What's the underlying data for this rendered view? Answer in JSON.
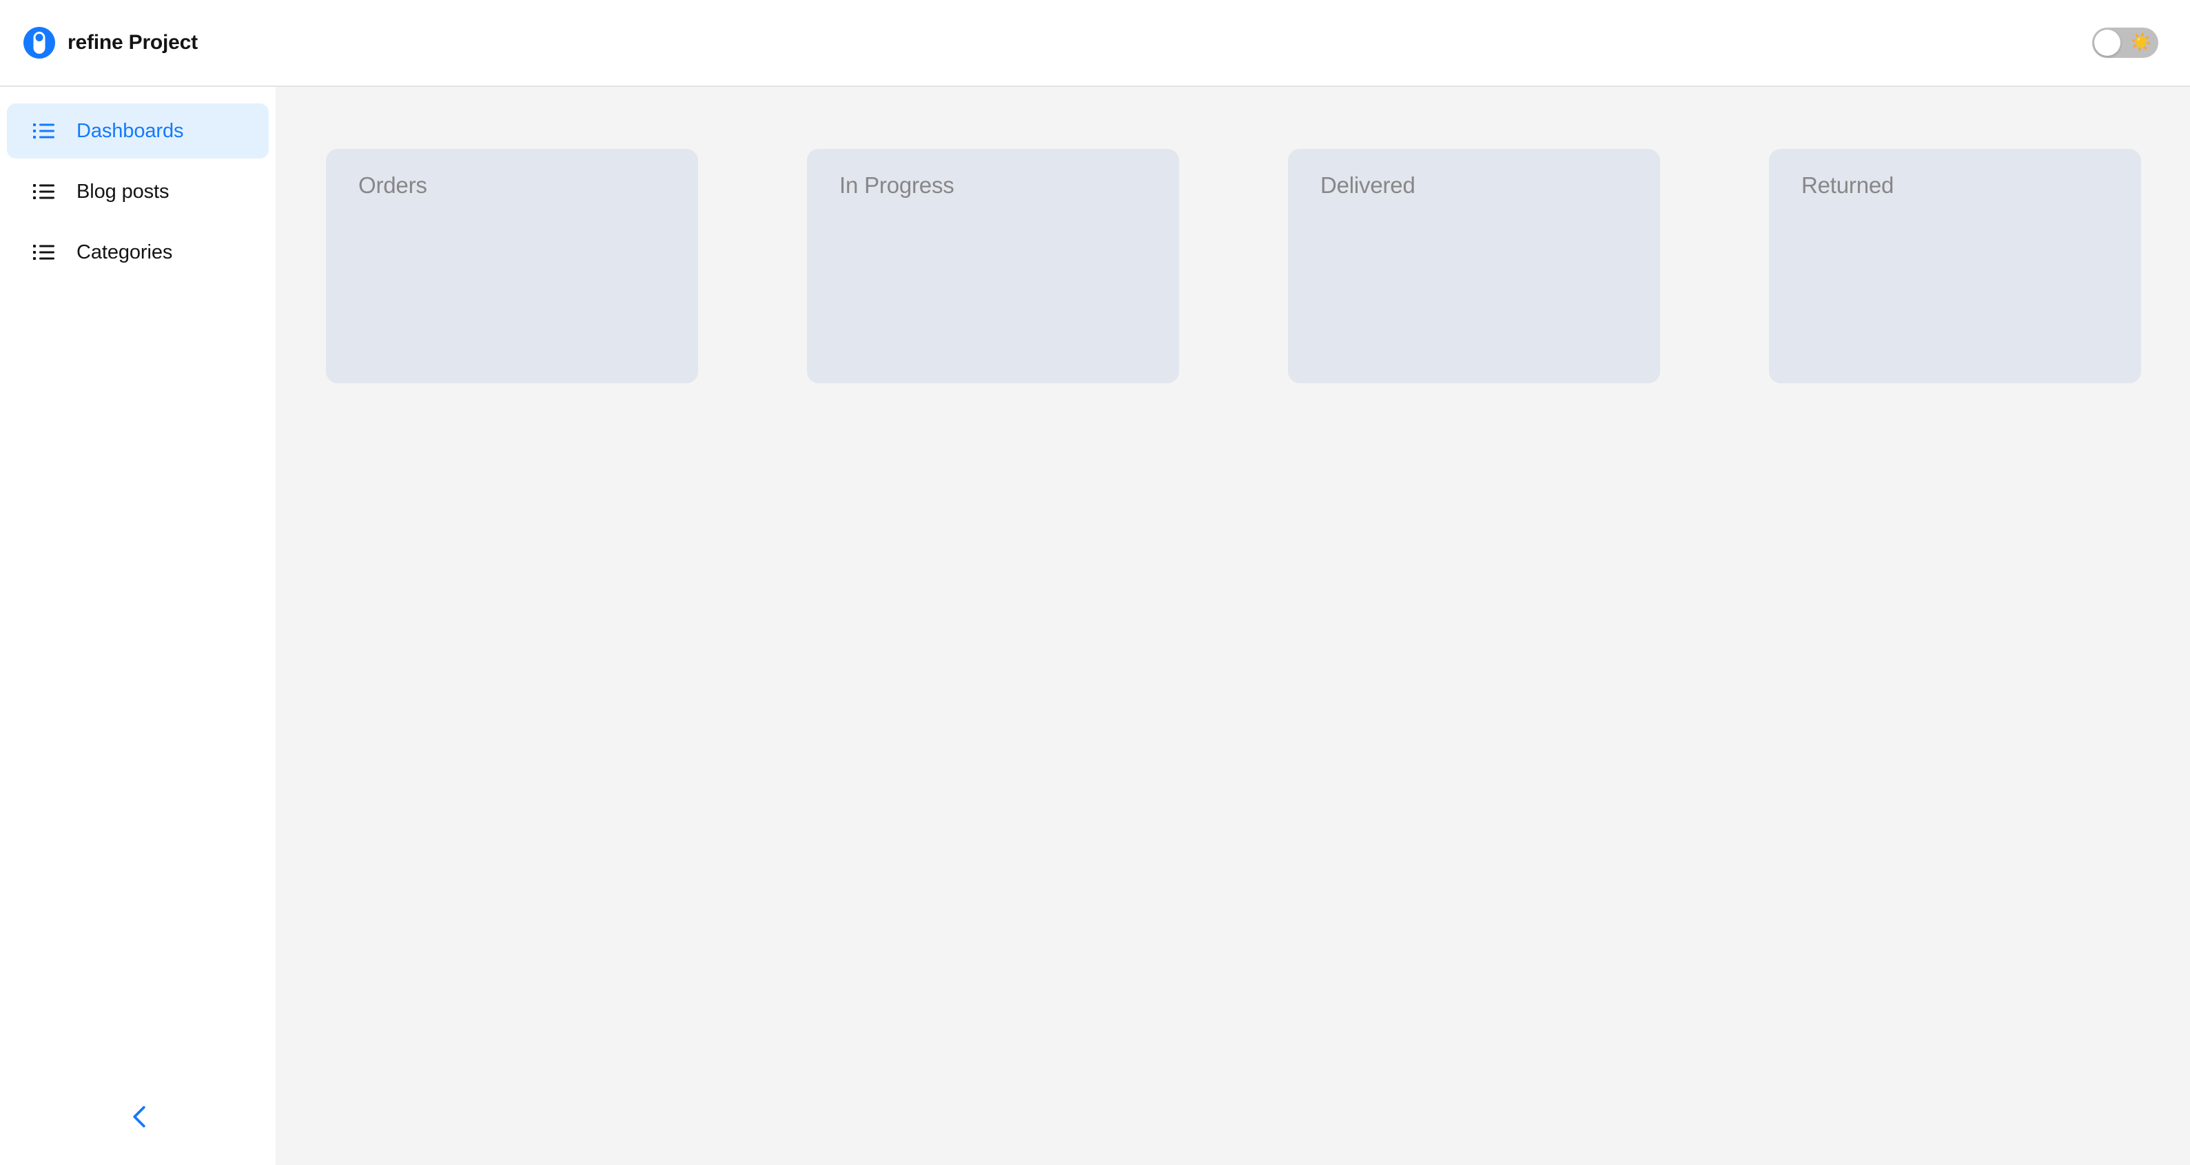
{
  "header": {
    "brand_title": "refine Project",
    "logo_icon": "refine-logo-icon",
    "accent_color": "#1479ff",
    "theme_toggle": {
      "state": "light",
      "icon": "sun-icon",
      "icon_glyph": "☀️"
    }
  },
  "sidebar": {
    "collapse_icon": "chevron-left-icon",
    "items": [
      {
        "label": "Dashboards",
        "icon": "list-icon",
        "active": true
      },
      {
        "label": "Blog posts",
        "icon": "list-icon",
        "active": false
      },
      {
        "label": "Categories",
        "icon": "list-icon",
        "active": false
      }
    ]
  },
  "main": {
    "background_color": "#f4f4f4",
    "cards": [
      {
        "title": "Orders"
      },
      {
        "title": "In Progress"
      },
      {
        "title": "Delivered"
      },
      {
        "title": "Returned"
      }
    ]
  }
}
